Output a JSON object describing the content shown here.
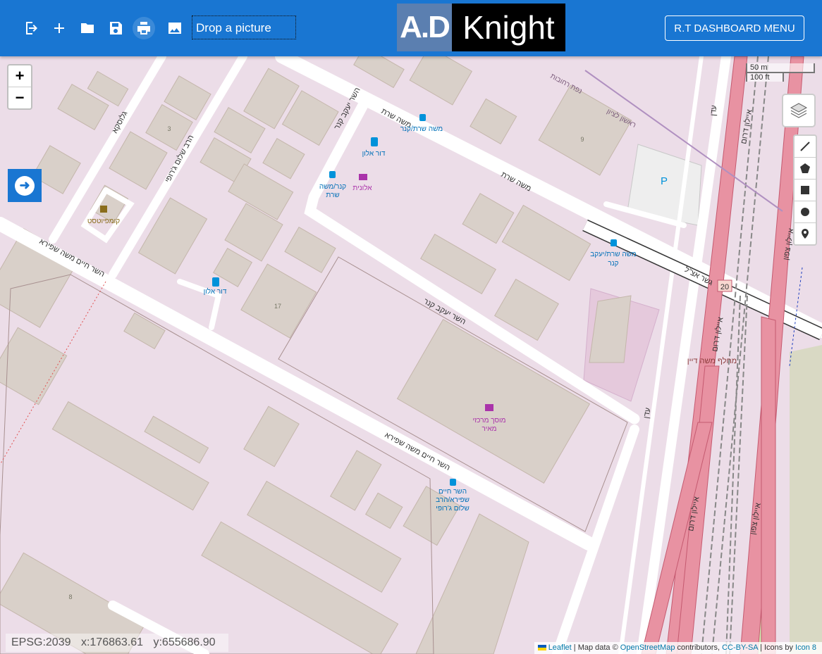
{
  "header": {
    "drop_label": "Drop a picture",
    "logo_left": "A.D",
    "logo_right": "Knight",
    "menu_label": "R.T DASHBOARD MENU",
    "icons": [
      "logout-icon",
      "add-icon",
      "folder-icon",
      "save-icon",
      "print-icon",
      "image-icon"
    ]
  },
  "map": {
    "zoom_in": "+",
    "zoom_out": "−",
    "scale_metric": "50 m",
    "scale_imperial": "100 ft",
    "coords": {
      "epsg": "EPSG:2039",
      "x": "x:176863.61",
      "y": "y:655686.90"
    },
    "attribution": {
      "leaflet": "Leaflet",
      "sep1": " | Map data © ",
      "osm": "OpenStreetMap",
      "contrib": " contributors, ",
      "license": "CC-BY-SA",
      "icons_by": " | Icons by ",
      "icon8": "Icon 8"
    },
    "labels": {
      "moshe_sharet_top": "משה שרת",
      "moshe_sharet_mid": "משה שרת",
      "stop_sharet_kaner": "משה שרת/קנר",
      "kaner_vert": "השר יעקב קנר",
      "dor_alon_1": "דור אלון",
      "aluna": "אלונית",
      "kaner_sharet": "קנר/משה",
      "kaner_sharet2": "שרת",
      "stop_sharet_yaakov": "משה שרת/יעקב",
      "stop_sharet_yaakov2": "קנר",
      "kaner_diag": "השר יעקב קנר",
      "glicksa": "גלוסקא",
      "harav_shalom": "הרב שלום ג'רופי",
      "kompitest": "קומפיוטסט",
      "shapira_top": "השר חיים משה שפירא",
      "dor_alon_2": "דור אלון",
      "num_17": "17",
      "num_3": "3",
      "num_9": "9",
      "num_8": "8",
      "parking": "P",
      "garage": "מוסך מרכזי",
      "garage2": "מאיר",
      "shapira_bottom": "השר חיים משה שפירא",
      "stop_shapira": "השר חיים",
      "stop_shapira2": "שפירא/הרב",
      "stop_shapira3": "שלום ג'רופי",
      "bridge": "גשר אצ\"ל",
      "road_20": "20",
      "ayalon_south_1": "איילון דרום",
      "ayalon_south_2": "איילון דרום",
      "ayalon_south_3": "איילון דרום",
      "ayalon_north_1": "איילון צפון",
      "ayalon_north_2": "איילון צפון",
      "machlef": "מחלף משה דיין",
      "eden_1": "עדן",
      "eden_2": "עדן",
      "rishon": "ראשון לציון",
      "nafat": "נפת רחובות"
    }
  }
}
